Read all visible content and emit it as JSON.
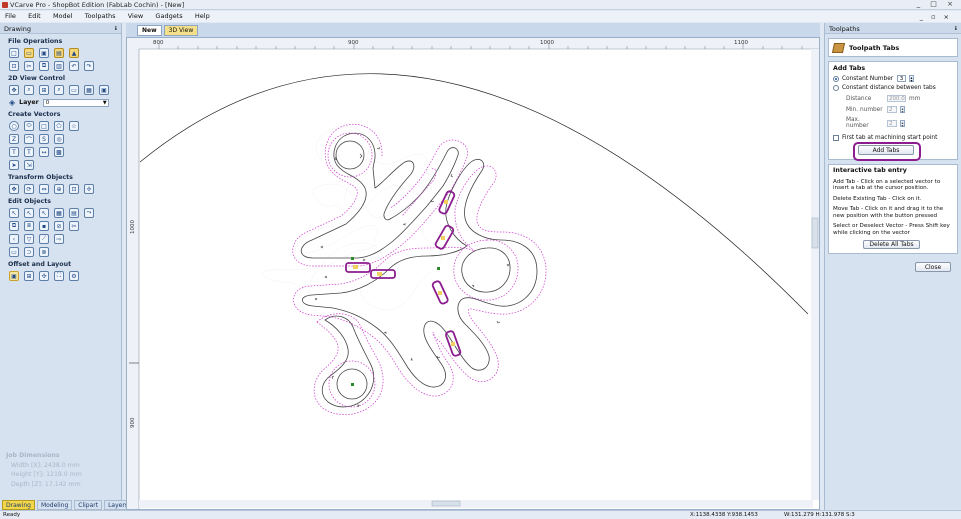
{
  "window": {
    "title": "VCarve Pro - ShopBot Edition (FabLab Cochin) - [New]",
    "controls": "_ □ ×"
  },
  "menu": {
    "items": [
      "File",
      "Edit",
      "Model",
      "Toolpaths",
      "View",
      "Gadgets",
      "Help"
    ],
    "mdi_controls": "_ ▫ ×"
  },
  "left_panel": {
    "title": "Drawing",
    "pin": "ᵻ",
    "sections": {
      "file_operations": "File Operations",
      "view_control": "2D View Control",
      "create_vectors": "Create Vectors",
      "transform": "Transform Objects",
      "edit_objects": "Edit Objects",
      "offset_layout": "Offset and Layout"
    },
    "layer": {
      "label": "Layer",
      "value": "0"
    },
    "job_dimensions": {
      "heading": "Job Dimensions",
      "width": "Width  [X]: 2438.0 mm",
      "height": "Height [Y]: 1219.0 mm",
      "depth": "Depth  [Z]: 17.142 mm"
    },
    "tabs": [
      "Drawing",
      "Modeling",
      "Clipart",
      "Layers"
    ]
  },
  "view_tabs": {
    "new": "New",
    "view3d": "3D View"
  },
  "ruler": {
    "top_labels": [
      "800",
      "900",
      "1000",
      "1100"
    ],
    "left_labels": [
      "1000",
      "900"
    ]
  },
  "right_panel": {
    "title": "Toolpaths",
    "pin": "ᵻ",
    "header": "Toolpath Tabs",
    "add_tabs": {
      "heading": "Add Tabs",
      "constant_number_label": "Constant Number",
      "constant_number_value": "3",
      "constant_distance_label": "Constant distance between tabs",
      "distance_label": "Distance",
      "distance_value": "200.0",
      "distance_unit": "mm",
      "min_label": "Min. number",
      "min_value": "2",
      "max_label": "Max. number",
      "max_value": "2",
      "first_tab_label": "First tab at machining start point",
      "add_button": "Add Tabs"
    },
    "interactive": {
      "heading": "Interactive tab entry",
      "line1": "Add Tab - Click on a selected vector to insert a tab at the cursor position.",
      "line2": "Delete Existing Tab - Click on it.",
      "line3": "Move Tab - Click on it and drag it to the new position with the button pressed",
      "line4": "Select or Deselect Vector - Press Shift key while clicking on the vector",
      "delete_all": "Delete All Tabs"
    },
    "close_button": "Close"
  },
  "status": {
    "ready": "Ready",
    "coords": "X:1138.4338 Y:938.1453",
    "dims": "W:131.279   H:131.978   S:3"
  },
  "colors": {
    "toolpath": "#cc33cc",
    "tab_highlight": "#8b1d8f",
    "tab_fill": "#f0d060",
    "node": "#2a8a2a"
  }
}
